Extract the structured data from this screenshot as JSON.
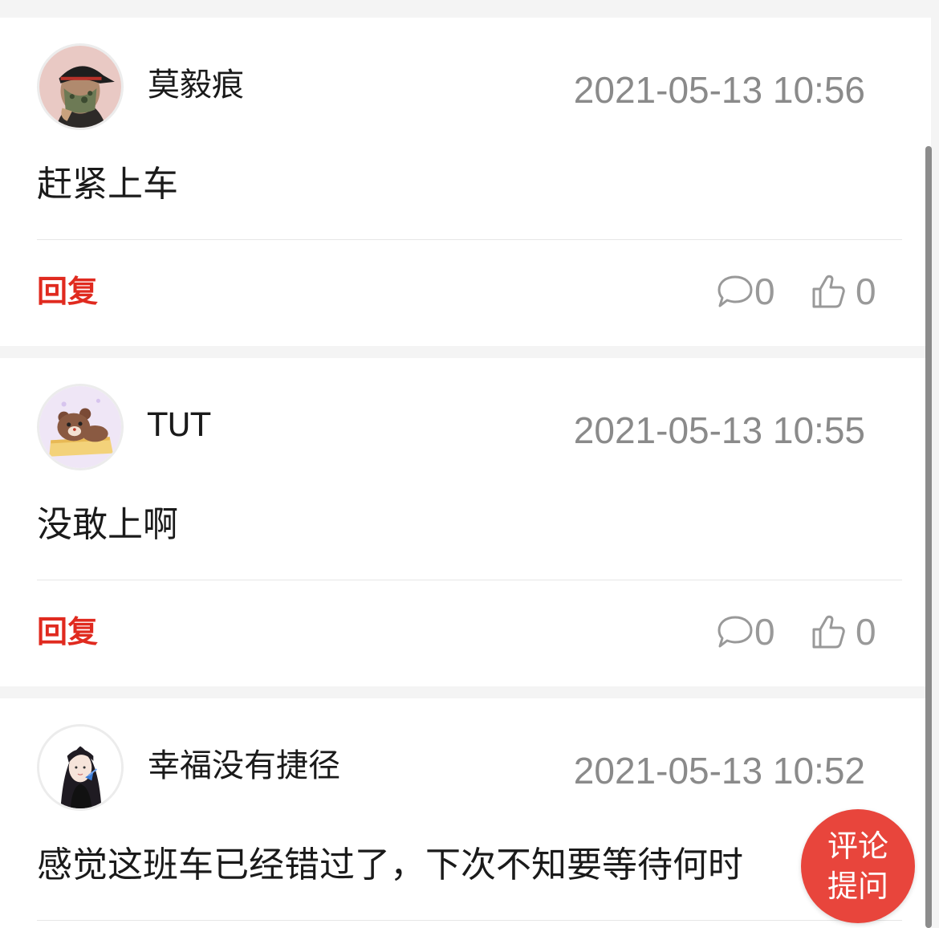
{
  "comments": [
    {
      "username": "莫毅痕",
      "timestamp": "2021-05-13 10:56",
      "content": "赶紧上车",
      "reply_label": "回复",
      "comment_count": "0",
      "like_count": "0",
      "avatar_icon": "avatar-man-cap-mask"
    },
    {
      "username": "TUT",
      "timestamp": "2021-05-13 10:55",
      "content": "没敢上啊",
      "reply_label": "回复",
      "comment_count": "0",
      "like_count": "0",
      "avatar_icon": "avatar-bear-cartoon"
    },
    {
      "username": "幸福没有捷径",
      "timestamp": "2021-05-13 10:52",
      "content": "感觉这班车已经错过了，下次不知要等待何时",
      "avatar_icon": "avatar-girl-illustration"
    }
  ],
  "fab": {
    "line1": "评论",
    "line2": "提问"
  },
  "colors": {
    "accent_red": "#e02a1f",
    "fab_red": "#e8453c",
    "meta_gray": "#8a8a8a",
    "background": "#f4f4f4"
  }
}
